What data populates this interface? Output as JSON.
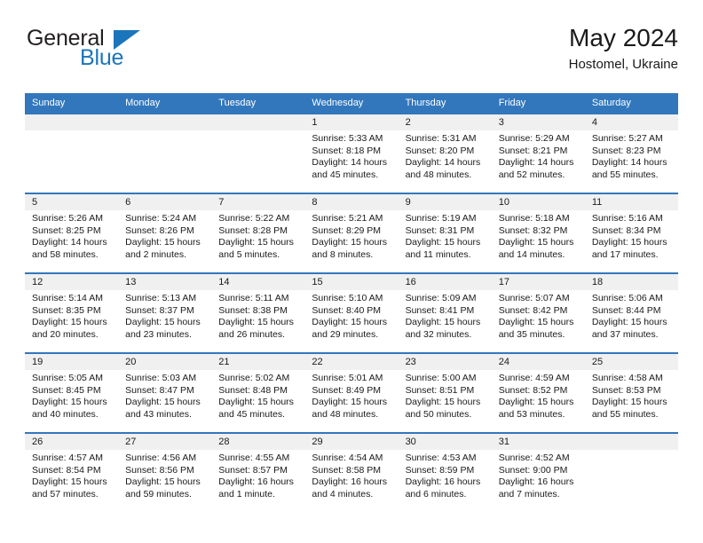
{
  "brand": {
    "name_part1": "General",
    "name_part2": "Blue",
    "flag_icon": "triangle-flag-icon"
  },
  "header": {
    "title": "May 2024",
    "subtitle": "Hostomel, Ukraine"
  },
  "colors": {
    "header_blue": "#3277bc",
    "brand_blue": "#1b75bb",
    "daynum_band": "#f0f0f0",
    "text": "#1a1a1a"
  },
  "weekdays": [
    "Sunday",
    "Monday",
    "Tuesday",
    "Wednesday",
    "Thursday",
    "Friday",
    "Saturday"
  ],
  "weeks": [
    [
      {
        "day": "",
        "empty": true
      },
      {
        "day": "",
        "empty": true
      },
      {
        "day": "",
        "empty": true
      },
      {
        "day": "1",
        "sunrise": "Sunrise: 5:33 AM",
        "sunset": "Sunset: 8:18 PM",
        "daylight_line1": "Daylight: 14 hours",
        "daylight_line2": "and 45 minutes."
      },
      {
        "day": "2",
        "sunrise": "Sunrise: 5:31 AM",
        "sunset": "Sunset: 8:20 PM",
        "daylight_line1": "Daylight: 14 hours",
        "daylight_line2": "and 48 minutes."
      },
      {
        "day": "3",
        "sunrise": "Sunrise: 5:29 AM",
        "sunset": "Sunset: 8:21 PM",
        "daylight_line1": "Daylight: 14 hours",
        "daylight_line2": "and 52 minutes."
      },
      {
        "day": "4",
        "sunrise": "Sunrise: 5:27 AM",
        "sunset": "Sunset: 8:23 PM",
        "daylight_line1": "Daylight: 14 hours",
        "daylight_line2": "and 55 minutes."
      }
    ],
    [
      {
        "day": "5",
        "sunrise": "Sunrise: 5:26 AM",
        "sunset": "Sunset: 8:25 PM",
        "daylight_line1": "Daylight: 14 hours",
        "daylight_line2": "and 58 minutes."
      },
      {
        "day": "6",
        "sunrise": "Sunrise: 5:24 AM",
        "sunset": "Sunset: 8:26 PM",
        "daylight_line1": "Daylight: 15 hours",
        "daylight_line2": "and 2 minutes."
      },
      {
        "day": "7",
        "sunrise": "Sunrise: 5:22 AM",
        "sunset": "Sunset: 8:28 PM",
        "daylight_line1": "Daylight: 15 hours",
        "daylight_line2": "and 5 minutes."
      },
      {
        "day": "8",
        "sunrise": "Sunrise: 5:21 AM",
        "sunset": "Sunset: 8:29 PM",
        "daylight_line1": "Daylight: 15 hours",
        "daylight_line2": "and 8 minutes."
      },
      {
        "day": "9",
        "sunrise": "Sunrise: 5:19 AM",
        "sunset": "Sunset: 8:31 PM",
        "daylight_line1": "Daylight: 15 hours",
        "daylight_line2": "and 11 minutes."
      },
      {
        "day": "10",
        "sunrise": "Sunrise: 5:18 AM",
        "sunset": "Sunset: 8:32 PM",
        "daylight_line1": "Daylight: 15 hours",
        "daylight_line2": "and 14 minutes."
      },
      {
        "day": "11",
        "sunrise": "Sunrise: 5:16 AM",
        "sunset": "Sunset: 8:34 PM",
        "daylight_line1": "Daylight: 15 hours",
        "daylight_line2": "and 17 minutes."
      }
    ],
    [
      {
        "day": "12",
        "sunrise": "Sunrise: 5:14 AM",
        "sunset": "Sunset: 8:35 PM",
        "daylight_line1": "Daylight: 15 hours",
        "daylight_line2": "and 20 minutes."
      },
      {
        "day": "13",
        "sunrise": "Sunrise: 5:13 AM",
        "sunset": "Sunset: 8:37 PM",
        "daylight_line1": "Daylight: 15 hours",
        "daylight_line2": "and 23 minutes."
      },
      {
        "day": "14",
        "sunrise": "Sunrise: 5:11 AM",
        "sunset": "Sunset: 8:38 PM",
        "daylight_line1": "Daylight: 15 hours",
        "daylight_line2": "and 26 minutes."
      },
      {
        "day": "15",
        "sunrise": "Sunrise: 5:10 AM",
        "sunset": "Sunset: 8:40 PM",
        "daylight_line1": "Daylight: 15 hours",
        "daylight_line2": "and 29 minutes."
      },
      {
        "day": "16",
        "sunrise": "Sunrise: 5:09 AM",
        "sunset": "Sunset: 8:41 PM",
        "daylight_line1": "Daylight: 15 hours",
        "daylight_line2": "and 32 minutes."
      },
      {
        "day": "17",
        "sunrise": "Sunrise: 5:07 AM",
        "sunset": "Sunset: 8:42 PM",
        "daylight_line1": "Daylight: 15 hours",
        "daylight_line2": "and 35 minutes."
      },
      {
        "day": "18",
        "sunrise": "Sunrise: 5:06 AM",
        "sunset": "Sunset: 8:44 PM",
        "daylight_line1": "Daylight: 15 hours",
        "daylight_line2": "and 37 minutes."
      }
    ],
    [
      {
        "day": "19",
        "sunrise": "Sunrise: 5:05 AM",
        "sunset": "Sunset: 8:45 PM",
        "daylight_line1": "Daylight: 15 hours",
        "daylight_line2": "and 40 minutes."
      },
      {
        "day": "20",
        "sunrise": "Sunrise: 5:03 AM",
        "sunset": "Sunset: 8:47 PM",
        "daylight_line1": "Daylight: 15 hours",
        "daylight_line2": "and 43 minutes."
      },
      {
        "day": "21",
        "sunrise": "Sunrise: 5:02 AM",
        "sunset": "Sunset: 8:48 PM",
        "daylight_line1": "Daylight: 15 hours",
        "daylight_line2": "and 45 minutes."
      },
      {
        "day": "22",
        "sunrise": "Sunrise: 5:01 AM",
        "sunset": "Sunset: 8:49 PM",
        "daylight_line1": "Daylight: 15 hours",
        "daylight_line2": "and 48 minutes."
      },
      {
        "day": "23",
        "sunrise": "Sunrise: 5:00 AM",
        "sunset": "Sunset: 8:51 PM",
        "daylight_line1": "Daylight: 15 hours",
        "daylight_line2": "and 50 minutes."
      },
      {
        "day": "24",
        "sunrise": "Sunrise: 4:59 AM",
        "sunset": "Sunset: 8:52 PM",
        "daylight_line1": "Daylight: 15 hours",
        "daylight_line2": "and 53 minutes."
      },
      {
        "day": "25",
        "sunrise": "Sunrise: 4:58 AM",
        "sunset": "Sunset: 8:53 PM",
        "daylight_line1": "Daylight: 15 hours",
        "daylight_line2": "and 55 minutes."
      }
    ],
    [
      {
        "day": "26",
        "sunrise": "Sunrise: 4:57 AM",
        "sunset": "Sunset: 8:54 PM",
        "daylight_line1": "Daylight: 15 hours",
        "daylight_line2": "and 57 minutes."
      },
      {
        "day": "27",
        "sunrise": "Sunrise: 4:56 AM",
        "sunset": "Sunset: 8:56 PM",
        "daylight_line1": "Daylight: 15 hours",
        "daylight_line2": "and 59 minutes."
      },
      {
        "day": "28",
        "sunrise": "Sunrise: 4:55 AM",
        "sunset": "Sunset: 8:57 PM",
        "daylight_line1": "Daylight: 16 hours",
        "daylight_line2": "and 1 minute."
      },
      {
        "day": "29",
        "sunrise": "Sunrise: 4:54 AM",
        "sunset": "Sunset: 8:58 PM",
        "daylight_line1": "Daylight: 16 hours",
        "daylight_line2": "and 4 minutes."
      },
      {
        "day": "30",
        "sunrise": "Sunrise: 4:53 AM",
        "sunset": "Sunset: 8:59 PM",
        "daylight_line1": "Daylight: 16 hours",
        "daylight_line2": "and 6 minutes."
      },
      {
        "day": "31",
        "sunrise": "Sunrise: 4:52 AM",
        "sunset": "Sunset: 9:00 PM",
        "daylight_line1": "Daylight: 16 hours",
        "daylight_line2": "and 7 minutes."
      },
      {
        "day": "",
        "empty": true
      }
    ]
  ]
}
